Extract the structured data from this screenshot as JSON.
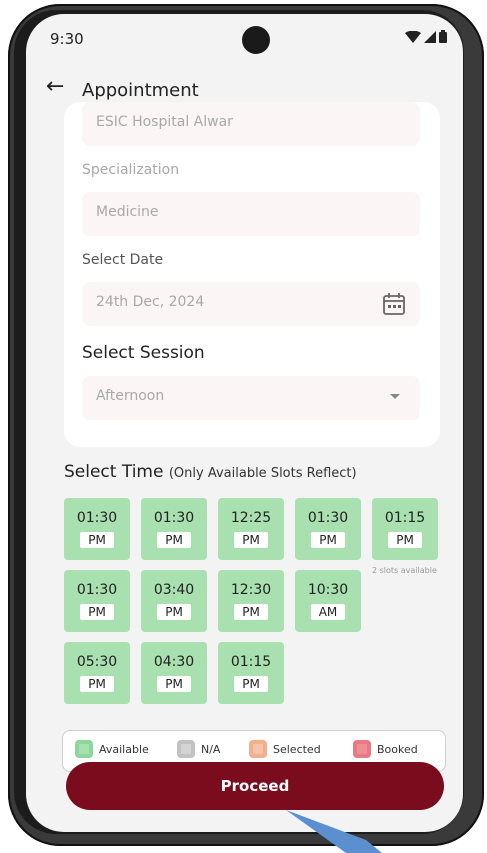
{
  "status": {
    "time": "9:30"
  },
  "header": {
    "title": "Appointment"
  },
  "form": {
    "hospital_value": "ESIC Hospital Alwar",
    "specialization_label": "Specialization",
    "specialization_value": "Medicine",
    "date_label": "Select Date",
    "date_value": "24th Dec, 2024",
    "session_label": "Select Session",
    "session_value": "Afternoon"
  },
  "time_section": {
    "heading": "Select Time",
    "subheading": "(Only Available Slots Reflect)",
    "slots": [
      {
        "time": "01:30",
        "period": "PM"
      },
      {
        "time": "01:30",
        "period": "PM"
      },
      {
        "time": "12:25",
        "period": "PM"
      },
      {
        "time": "01:30",
        "period": "PM"
      },
      {
        "time": "01:15",
        "period": "PM"
      },
      {
        "time": "01:30",
        "period": "PM"
      },
      {
        "time": "03:40",
        "period": "PM"
      },
      {
        "time": "12:30",
        "period": "PM"
      },
      {
        "time": "10:30",
        "period": "AM"
      },
      {
        "time": "05:30",
        "period": "PM"
      },
      {
        "time": "04:30",
        "period": "PM"
      },
      {
        "time": "01:15",
        "period": "PM"
      }
    ],
    "slots_available_note": "2 slots available"
  },
  "legend": {
    "available": "Available",
    "na": "N/A",
    "selected": "Selected",
    "booked": "Booked",
    "colors": {
      "available": "#a8e0b0",
      "na": "#d4d4d4",
      "selected": "#f6c2a9",
      "booked": "#ef8e96"
    }
  },
  "actions": {
    "proceed_label": "Proceed"
  },
  "colors": {
    "primary": "#7a0c1e",
    "slot_bg": "#a8e0b0"
  },
  "icons": [
    "back-arrow-icon",
    "calendar-icon",
    "dropdown-arrow-icon",
    "wifi-icon",
    "signal-icon",
    "battery-icon"
  ]
}
